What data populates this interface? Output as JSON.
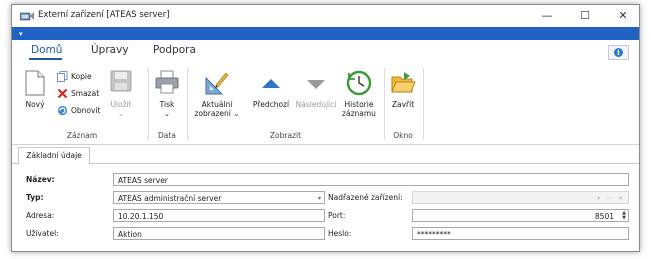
{
  "window": {
    "title": "Externí zařízení [ATEAS server]",
    "controls": {
      "minimize": "—",
      "maximize": "☐",
      "close": "✕"
    }
  },
  "qat": {
    "arrow": "▾"
  },
  "ribbon": {
    "tabs": [
      "Domů",
      "Úpravy",
      "Podpora"
    ],
    "active_tab": "Domů",
    "info_glyph": "i",
    "groups": {
      "zaznam": {
        "label": "Záznam",
        "novy": "Nový",
        "kopie": "Kopie",
        "smazat": "Smazat",
        "obnovit": "Obnovit",
        "ulozit": "Uložit",
        "ulozit_dropdown": "⌄"
      },
      "data": {
        "label": "Data",
        "tisk": "Tisk",
        "tisk_dropdown": "⌄"
      },
      "zobrazit": {
        "label": "Zobrazit",
        "aktualni_line1": "Aktuální",
        "aktualni_line2": "zobrazení ⌄",
        "predchozi": "Předchozí",
        "nasledujici": "Následující",
        "historie_line1": "Historie",
        "historie_line2": "záznamu"
      },
      "okno": {
        "label": "Okno",
        "zavrit": "Zavřít"
      }
    }
  },
  "form": {
    "tab": "Základní údaje",
    "nazev": {
      "label": "Název:",
      "value": "ATEAS server"
    },
    "typ": {
      "label": "Typ:",
      "value": "ATEAS administrační server",
      "arrow": "▾"
    },
    "nadrazene": {
      "label": "Nadřazené zařízení:",
      "value": "",
      "controls": "▾ ⋯ ✕"
    },
    "adresa": {
      "label": "Adresa:",
      "value": "10.20.1.150"
    },
    "port": {
      "label": "Port:",
      "value": "8501",
      "up": "▲",
      "down": "▼"
    },
    "uzivatel": {
      "label": "Uživatel:",
      "value": "Aktion"
    },
    "heslo": {
      "label": "Heslo:",
      "value": "*********"
    }
  }
}
